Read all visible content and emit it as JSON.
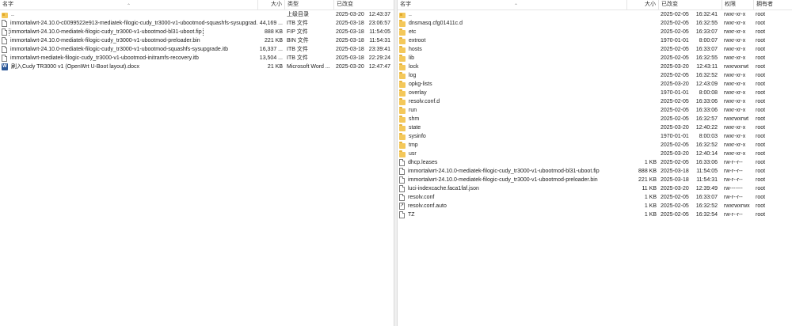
{
  "left": {
    "headers": {
      "name": "名字",
      "size": "大小",
      "type": "类型",
      "date": "已改变"
    },
    "rows": [
      {
        "icon": "up",
        "name": "..",
        "size": "",
        "type": "上级目录",
        "date": "2025-03-20",
        "time": "12:43:37"
      },
      {
        "icon": "file",
        "name": "immortalwrt-24.10.0-c0099522e913-mediatek-filogic-cudy_tr3000-v1-ubootmod-squashfs-sysupgrad...",
        "size": "44,169 ...",
        "type": "ITB 文件",
        "date": "2025-03-18",
        "time": "23:06:57"
      },
      {
        "icon": "file",
        "name": "immortalwrt-24.10.0-mediatek-filogic-cudy_tr3000-v1-ubootmod-bl31-uboot.fip",
        "size": "888 KB",
        "type": "FIP 文件",
        "date": "2025-03-18",
        "time": "11:54:05",
        "selected": true
      },
      {
        "icon": "file",
        "name": "immortalwrt-24.10.0-mediatek-filogic-cudy_tr3000-v1-ubootmod-preloader.bin",
        "size": "221 KB",
        "type": "BIN 文件",
        "date": "2025-03-18",
        "time": "11:54:31"
      },
      {
        "icon": "file",
        "name": "immortalwrt-24.10.0-mediatek-filogic-cudy_tr3000-v1-ubootmod-squashfs-sysupgrade.itb",
        "size": "16,337 ...",
        "type": "ITB 文件",
        "date": "2025-03-18",
        "time": "23:39:41"
      },
      {
        "icon": "file",
        "name": "immortalwrt-mediatek-filogic-cudy_tr3000-v1-ubootmod-initramfs-recovery.itb",
        "size": "13,504 ...",
        "type": "ITB 文件",
        "date": "2025-03-18",
        "time": "22:29:24"
      },
      {
        "icon": "word",
        "name": "刷入Cudy TR3000 v1 (OpenWrt U-Boot layout).docx",
        "size": "21 KB",
        "type": "Microsoft Word ...",
        "date": "2025-03-20",
        "time": "12:47:47"
      }
    ]
  },
  "right": {
    "headers": {
      "name": "名字",
      "size": "大小",
      "date": "已改变",
      "perm": "权限",
      "owner": "拥有者"
    },
    "rows": [
      {
        "icon": "up",
        "name": "..",
        "size": "",
        "date": "2025-02-05",
        "time": "16:32:41",
        "perm": "rwxr-xr-x",
        "owner": "root"
      },
      {
        "icon": "folder",
        "name": "dnsmasq.cfg01411c.d",
        "size": "",
        "date": "2025-02-05",
        "time": "16:32:55",
        "perm": "rwxr-xr-x",
        "owner": "root"
      },
      {
        "icon": "folder",
        "name": "etc",
        "size": "",
        "date": "2025-02-05",
        "time": "16:33:07",
        "perm": "rwxr-xr-x",
        "owner": "root"
      },
      {
        "icon": "folder",
        "name": "extroot",
        "size": "",
        "date": "1970-01-01",
        "time": "8:00:07",
        "perm": "rwxr-xr-x",
        "owner": "root"
      },
      {
        "icon": "folder",
        "name": "hosts",
        "size": "",
        "date": "2025-02-05",
        "time": "16:33:07",
        "perm": "rwxr-xr-x",
        "owner": "root"
      },
      {
        "icon": "folder",
        "name": "lib",
        "size": "",
        "date": "2025-02-05",
        "time": "16:32:55",
        "perm": "rwxr-xr-x",
        "owner": "root"
      },
      {
        "icon": "folder",
        "name": "lock",
        "size": "",
        "date": "2025-03-20",
        "time": "12:43:11",
        "perm": "rwxrwxrwt",
        "owner": "root"
      },
      {
        "icon": "folder",
        "name": "log",
        "size": "",
        "date": "2025-02-05",
        "time": "16:32:52",
        "perm": "rwxr-xr-x",
        "owner": "root"
      },
      {
        "icon": "folder",
        "name": "opkg-lists",
        "size": "",
        "date": "2025-03-20",
        "time": "12:43:09",
        "perm": "rwxr-xr-x",
        "owner": "root"
      },
      {
        "icon": "folder",
        "name": "overlay",
        "size": "",
        "date": "1970-01-01",
        "time": "8:00:08",
        "perm": "rwxr-xr-x",
        "owner": "root"
      },
      {
        "icon": "folder",
        "name": "resolv.conf.d",
        "size": "",
        "date": "2025-02-05",
        "time": "16:33:06",
        "perm": "rwxr-xr-x",
        "owner": "root"
      },
      {
        "icon": "folder",
        "name": "run",
        "size": "",
        "date": "2025-02-05",
        "time": "16:33:06",
        "perm": "rwxr-xr-x",
        "owner": "root"
      },
      {
        "icon": "folder",
        "name": "shm",
        "size": "",
        "date": "2025-02-05",
        "time": "16:32:57",
        "perm": "rwxrwxrwt",
        "owner": "root"
      },
      {
        "icon": "folder",
        "name": "state",
        "size": "",
        "date": "2025-03-20",
        "time": "12:40:22",
        "perm": "rwxr-xr-x",
        "owner": "root"
      },
      {
        "icon": "folder",
        "name": "sysinfo",
        "size": "",
        "date": "1970-01-01",
        "time": "8:00:03",
        "perm": "rwxr-xr-x",
        "owner": "root"
      },
      {
        "icon": "folder",
        "name": "tmp",
        "size": "",
        "date": "2025-02-05",
        "time": "16:32:52",
        "perm": "rwxr-xr-x",
        "owner": "root"
      },
      {
        "icon": "folder",
        "name": "usr",
        "size": "",
        "date": "2025-03-20",
        "time": "12:40:14",
        "perm": "rwxr-xr-x",
        "owner": "root"
      },
      {
        "icon": "file",
        "name": "dhcp.leases",
        "size": "1 KB",
        "date": "2025-02-05",
        "time": "16:33:06",
        "perm": "rw-r--r--",
        "owner": "root"
      },
      {
        "icon": "file",
        "name": "immortalwrt-24.10.0-mediatek-filogic-cudy_tr3000-v1-ubootmod-bl31-uboot.fip",
        "size": "888 KB",
        "date": "2025-03-18",
        "time": "11:54:05",
        "perm": "rw-r--r--",
        "owner": "root"
      },
      {
        "icon": "file",
        "name": "immortalwrt-24.10.0-mediatek-filogic-cudy_tr3000-v1-ubootmod-preloader.bin",
        "size": "221 KB",
        "date": "2025-03-18",
        "time": "11:54:31",
        "perm": "rw-r--r--",
        "owner": "root"
      },
      {
        "icon": "file",
        "name": "luci-indexcache.faca1faf.json",
        "size": "11 KB",
        "date": "2025-03-20",
        "time": "12:39:49",
        "perm": "rw-------",
        "owner": "root"
      },
      {
        "icon": "file",
        "name": "resolv.conf",
        "size": "1 KB",
        "date": "2025-02-05",
        "time": "16:33:07",
        "perm": "rw-r--r--",
        "owner": "root"
      },
      {
        "icon": "link",
        "name": "resolv.conf.auto",
        "size": "1 KB",
        "date": "2025-02-05",
        "time": "16:32:52",
        "perm": "rwxrwxrwx",
        "owner": "root"
      },
      {
        "icon": "file",
        "name": "TZ",
        "size": "1 KB",
        "date": "2025-02-05",
        "time": "16:32:54",
        "perm": "rw-r--r--",
        "owner": "root"
      }
    ]
  }
}
